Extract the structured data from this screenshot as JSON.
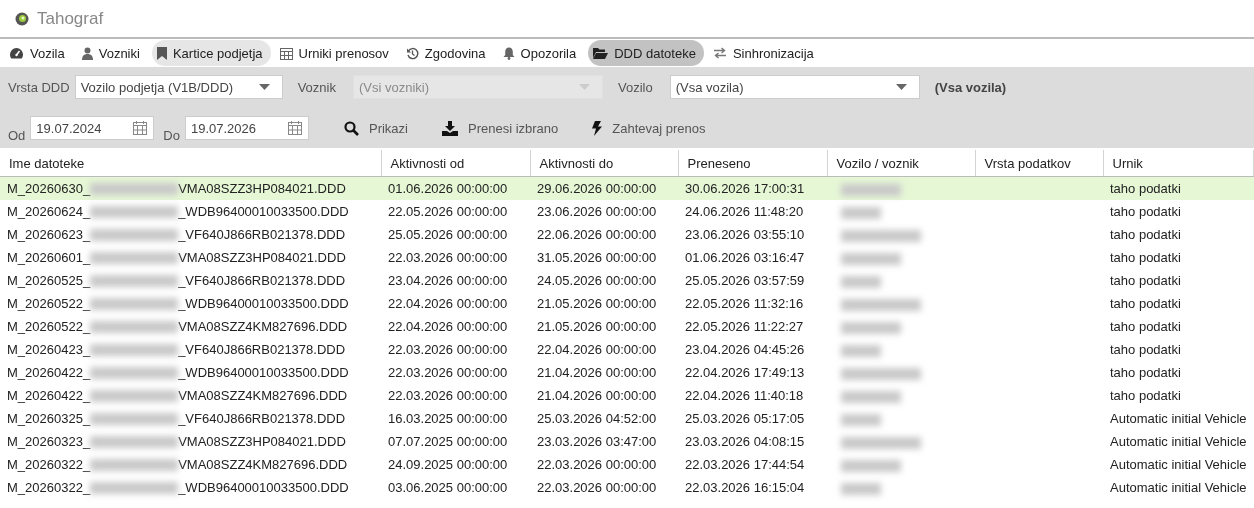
{
  "app": {
    "title": "Tahograf"
  },
  "tabs": [
    {
      "label": "Vozila",
      "selected": false,
      "hovered": false
    },
    {
      "label": "Vozniki",
      "selected": false,
      "hovered": false
    },
    {
      "label": "Kartice podjetja",
      "selected": false,
      "hovered": true
    },
    {
      "label": "Urniki prenosov",
      "selected": false,
      "hovered": false
    },
    {
      "label": "Zgodovina",
      "selected": false,
      "hovered": false
    },
    {
      "label": "Opozorila",
      "selected": false,
      "hovered": false
    },
    {
      "label": "DDD datoteke",
      "selected": true,
      "hovered": false
    },
    {
      "label": "Sinhronizacija",
      "selected": false,
      "hovered": false
    }
  ],
  "filters": {
    "type_label": "Vrsta DDD",
    "type_value": "Vozilo podjetja (V1B/DDD)",
    "driver_label": "Voznik",
    "driver_placeholder": "(Vsi vozniki)",
    "driver_disabled": true,
    "vehicle_label": "Vozilo",
    "vehicle_value": "(Vsa vozila)",
    "vehicle_summary": "(Vsa vozila)",
    "from_label": "Od",
    "from_value": "19.07.2024",
    "to_label": "Do",
    "to_value": "19.07.2026"
  },
  "actions": [
    "Prikazi",
    "Prenesi izbrano",
    "Zahtevaj prenos"
  ],
  "table": {
    "columns": [
      "Ime datoteke",
      "Aktivnosti od",
      "Aktivnosti do",
      "Preneseno",
      "Vozilo / voznik",
      "Vrsta podatkov",
      "Urnik"
    ],
    "rows": [
      {
        "file_start": "M_20260630_",
        "file_end": "VMA08SZZ3HP084021.DDD",
        "from": "01.06.2026 00:00:00",
        "to": "29.06.2026 00:00:00",
        "downloaded": "30.06.2026 17:00:31",
        "schedule": "taho podatki",
        "selected": true
      },
      {
        "file_start": "M_20260624_",
        "file_end": "_WDB96400010033500.DDD",
        "from": "22.05.2026 00:00:00",
        "to": "23.06.2026 00:00:00",
        "downloaded": "24.06.2026 11:48:20",
        "schedule": "taho podatki",
        "selected": false
      },
      {
        "file_start": "M_20260623_",
        "file_end": "_VF640J866RB021378.DDD",
        "from": "25.05.2026 00:00:00",
        "to": "22.06.2026 00:00:00",
        "downloaded": "23.06.2026 03:55:10",
        "schedule": "taho podatki",
        "selected": false
      },
      {
        "file_start": "M_20260601_",
        "file_end": "VMA08SZZ3HP084021.DDD",
        "from": "22.03.2026 00:00:00",
        "to": "31.05.2026 00:00:00",
        "downloaded": "01.06.2026 03:16:47",
        "schedule": "taho podatki",
        "selected": false
      },
      {
        "file_start": "M_20260525_",
        "file_end": "_VF640J866RB021378.DDD",
        "from": "23.04.2026 00:00:00",
        "to": "24.05.2026 00:00:00",
        "downloaded": "25.05.2026 03:57:59",
        "schedule": "taho podatki",
        "selected": false
      },
      {
        "file_start": "M_20260522_",
        "file_end": "_WDB96400010033500.DDD",
        "from": "22.04.2026 00:00:00",
        "to": "21.05.2026 00:00:00",
        "downloaded": "22.05.2026 11:32:16",
        "schedule": "taho podatki",
        "selected": false
      },
      {
        "file_start": "M_20260522_",
        "file_end": "VMA08SZZ4KM827696.DDD",
        "from": "22.04.2026 00:00:00",
        "to": "21.05.2026 00:00:00",
        "downloaded": "22.05.2026 11:22:27",
        "schedule": "taho podatki",
        "selected": false
      },
      {
        "file_start": "M_20260423_",
        "file_end": "_VF640J866RB021378.DDD",
        "from": "22.03.2026 00:00:00",
        "to": "22.04.2026 00:00:00",
        "downloaded": "23.04.2026 04:45:26",
        "schedule": "taho podatki",
        "selected": false
      },
      {
        "file_start": "M_20260422_",
        "file_end": "_WDB96400010033500.DDD",
        "from": "22.03.2026 00:00:00",
        "to": "21.04.2026 00:00:00",
        "downloaded": "22.04.2026 17:49:13",
        "schedule": "taho podatki",
        "selected": false
      },
      {
        "file_start": "M_20260422_",
        "file_end": "VMA08SZZ4KM827696.DDD",
        "from": "22.03.2026 00:00:00",
        "to": "21.04.2026 00:00:00",
        "downloaded": "22.04.2026 11:40:18",
        "schedule": "taho podatki",
        "selected": false
      },
      {
        "file_start": "M_20260325_",
        "file_end": "_VF640J866RB021378.DDD",
        "from": "16.03.2025 00:00:00",
        "to": "25.03.2026 04:52:00",
        "downloaded": "25.03.2026 05:17:05",
        "schedule": "Automatic initial Vehicle",
        "selected": false
      },
      {
        "file_start": "M_20260323_",
        "file_end": "VMA08SZZ3HP084021.DDD",
        "from": "07.07.2025 00:00:00",
        "to": "23.03.2026 03:47:00",
        "downloaded": "23.03.2026 04:08:15",
        "schedule": "Automatic initial Vehicle",
        "selected": false
      },
      {
        "file_start": "M_20260322_",
        "file_end": "VMA08SZZ4KM827696.DDD",
        "from": "24.09.2025 00:00:00",
        "to": "22.03.2026 00:00:00",
        "downloaded": "22.03.2026 17:44:54",
        "schedule": "Automatic initial Vehicle",
        "selected": false
      },
      {
        "file_start": "M_20260322_",
        "file_end": "_WDB96400010033500.DDD",
        "from": "03.06.2025 00:00:00",
        "to": "22.03.2026 00:00:00",
        "downloaded": "22.03.2026 16:15:04",
        "schedule": "Automatic initial Vehicle",
        "selected": false
      }
    ]
  }
}
